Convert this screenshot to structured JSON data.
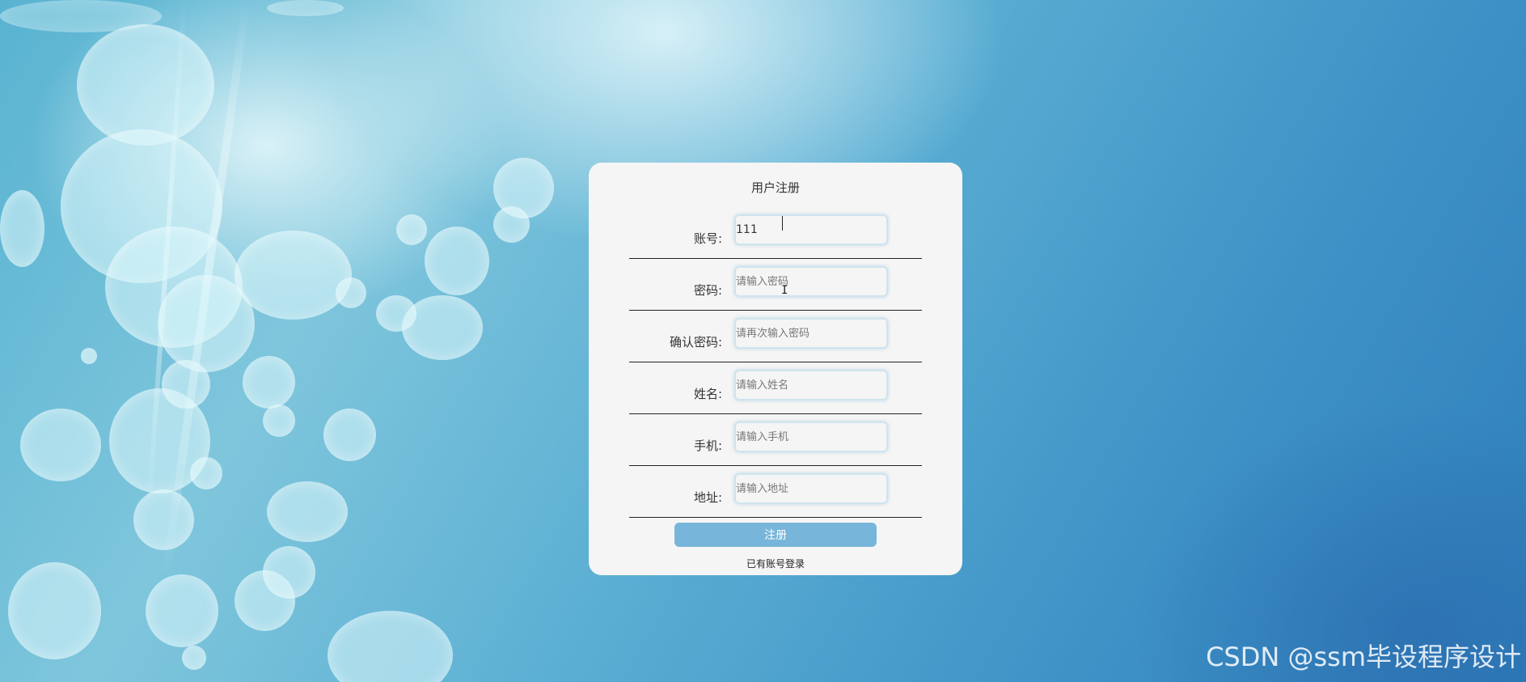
{
  "form": {
    "title": "用户注册",
    "fields": [
      {
        "label": "账号:",
        "value": "111",
        "placeholder": ""
      },
      {
        "label": "密码:",
        "value": "",
        "placeholder": "请输入密码"
      },
      {
        "label": "确认密码:",
        "value": "",
        "placeholder": "请再次输入密码"
      },
      {
        "label": "姓名:",
        "value": "",
        "placeholder": "请输入姓名"
      },
      {
        "label": "手机:",
        "value": "",
        "placeholder": "请输入手机"
      },
      {
        "label": "地址:",
        "value": "",
        "placeholder": "请输入地址"
      }
    ],
    "submit_label": "注册",
    "login_link": "已有账号登录"
  },
  "watermark": "CSDN @ssm毕设程序设计",
  "colors": {
    "card_bg": "#f5f5f5",
    "button_bg": "#77b6da",
    "background_blue": "#3f93c7"
  }
}
